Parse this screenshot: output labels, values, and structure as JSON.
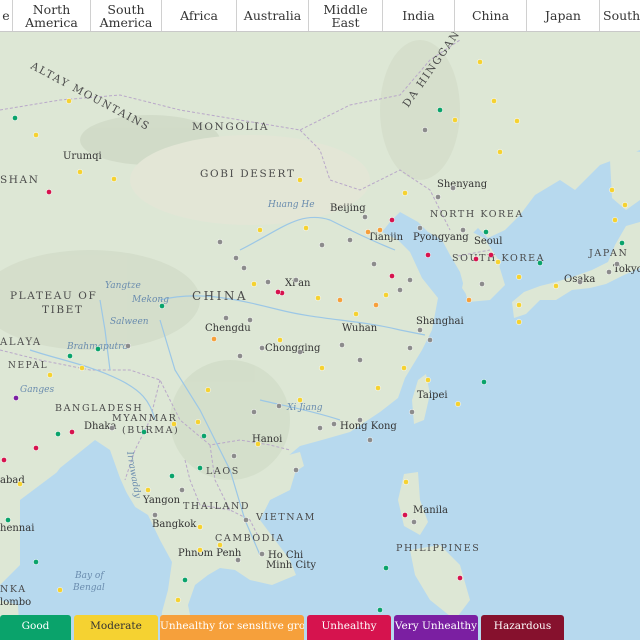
{
  "tabs": [
    {
      "label": "e"
    },
    {
      "label": "North\nAmerica"
    },
    {
      "label": "South\nAmerica"
    },
    {
      "label": "Africa"
    },
    {
      "label": "Australia"
    },
    {
      "label": "Middle East"
    },
    {
      "label": "India"
    },
    {
      "label": "China"
    },
    {
      "label": "Japan"
    },
    {
      "label": "South K"
    }
  ],
  "legend": [
    {
      "label": "Good",
      "color": "#0aa36b"
    },
    {
      "label": "Moderate",
      "color": "#f5d231"
    },
    {
      "label": "Unhealthy for sensitive groups",
      "color": "#f6a03b"
    },
    {
      "label": "Unhealthy",
      "color": "#d6134e"
    },
    {
      "label": "Very Unhealthy",
      "color": "#7b1fa2"
    },
    {
      "label": "Hazardous",
      "color": "#86112d"
    }
  ],
  "map_labels": {
    "altay": "ALTAY MOUNTAINS",
    "mongolia": "MONGOLIA",
    "gobi": "GOBI DESERT",
    "da_hinggan": "DA HINGGAN",
    "shan": "SHAN",
    "urumqi": "Urumqi",
    "plateau": "PLATEAU OF",
    "tibet": "TIBET",
    "china": "CHINA",
    "xian": "Xi'an",
    "chengdu": "Chengdu",
    "chongqing": "Chongqing",
    "wuhan": "Wuhan",
    "shanghai": "Shanghai",
    "beijing": "Beijing",
    "tianjin": "Tianjin",
    "shenyang": "Shenyang",
    "north_korea": "NORTH KOREA",
    "pyongyang": "Pyongyang",
    "seoul": "Seoul",
    "south_korea": "SOUTH KOREA",
    "japan": "JAPAN",
    "osaka": "Osaka",
    "tokyo": "Tokyo",
    "taipei": "Taipei",
    "hong_kong": "Hong Kong",
    "hanoi": "Hanoi",
    "laos": "LAOS",
    "thailand": "THAILAND",
    "bangkok": "Bangkok",
    "yangon": "Yangon",
    "myanmar": "MYANMAR",
    "burma": "(BURMA)",
    "cambodia": "CAMBODIA",
    "phnom_penh": "Phnom Penh",
    "vietnam": "VIETNAM",
    "ho_chi": "Ho Chi",
    "minh_city": "Minh City",
    "manila": "Manila",
    "philippines": "PHILIPPINES",
    "bangladesh": "BANGLADESH",
    "dhaka": "Dhaka",
    "nepal": "NEPAL",
    "alaya": "ALAYA",
    "bay_of": "Bay of",
    "bengal": "Bengal",
    "nka": "NKA",
    "lombo": "lombo",
    "chennai": "hennai",
    "abad": "abad",
    "huang_he": "Huang He",
    "yangtze": "Yangtze",
    "mekong": "Mekong",
    "salween": "Salween",
    "brahmaputra": "Brahmaputra",
    "ganges": "Ganges",
    "xi_jiang": "Xi Jiang",
    "irrawaddy": "Irrawaddy"
  }
}
